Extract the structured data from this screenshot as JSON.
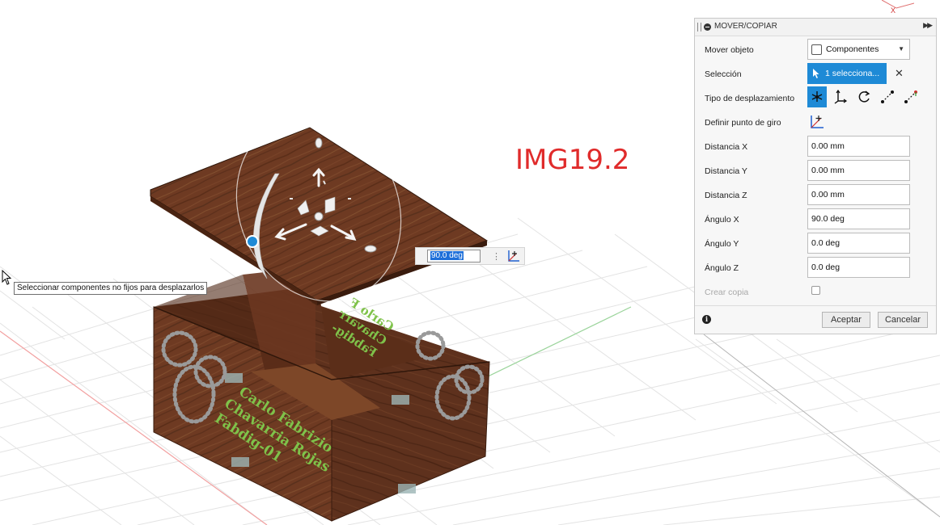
{
  "image_label": "IMG19.2",
  "tooltip": "Seleccionar componentes no fijos para desplazarlos",
  "angle_input": {
    "value": "90.0 deg"
  },
  "lid_text": "Carlo F\nChavarr\nFabdig-",
  "box_text": [
    "Carlo Fabrizio",
    "Chavarria Rojas",
    "Fabdig-01"
  ],
  "panel": {
    "title": "MOVER/COPIAR",
    "rows": {
      "mover_objeto": {
        "label": "Mover objeto",
        "value": "Componentes"
      },
      "seleccion": {
        "label": "Selección",
        "value": "1 selecciona..."
      },
      "tipo": {
        "label": "Tipo de desplazamiento"
      },
      "pivot": {
        "label": "Definir punto de giro"
      },
      "dist_x": {
        "label": "Distancia X",
        "value": "0.00 mm"
      },
      "dist_y": {
        "label": "Distancia Y",
        "value": "0.00 mm"
      },
      "dist_z": {
        "label": "Distancia Z",
        "value": "0.00 mm"
      },
      "ang_x": {
        "label": "Ángulo X",
        "value": "90.0 deg"
      },
      "ang_y": {
        "label": "Ángulo Y",
        "value": "0.0 deg"
      },
      "ang_z": {
        "label": "Ángulo Z",
        "value": "0.0 deg"
      },
      "copia": {
        "label": "Crear copia",
        "checked": false
      }
    },
    "buttons": {
      "ok": "Aceptar",
      "cancel": "Cancelar"
    },
    "accent_color": "#1e8ad6"
  },
  "icons": [
    "pointer-cursor-icon",
    "pivot-icon",
    "free-move-icon",
    "translate-icon",
    "rotate-icon",
    "point-to-point-icon",
    "point-to-position-icon",
    "info-icon",
    "close-icon",
    "component-icon"
  ]
}
